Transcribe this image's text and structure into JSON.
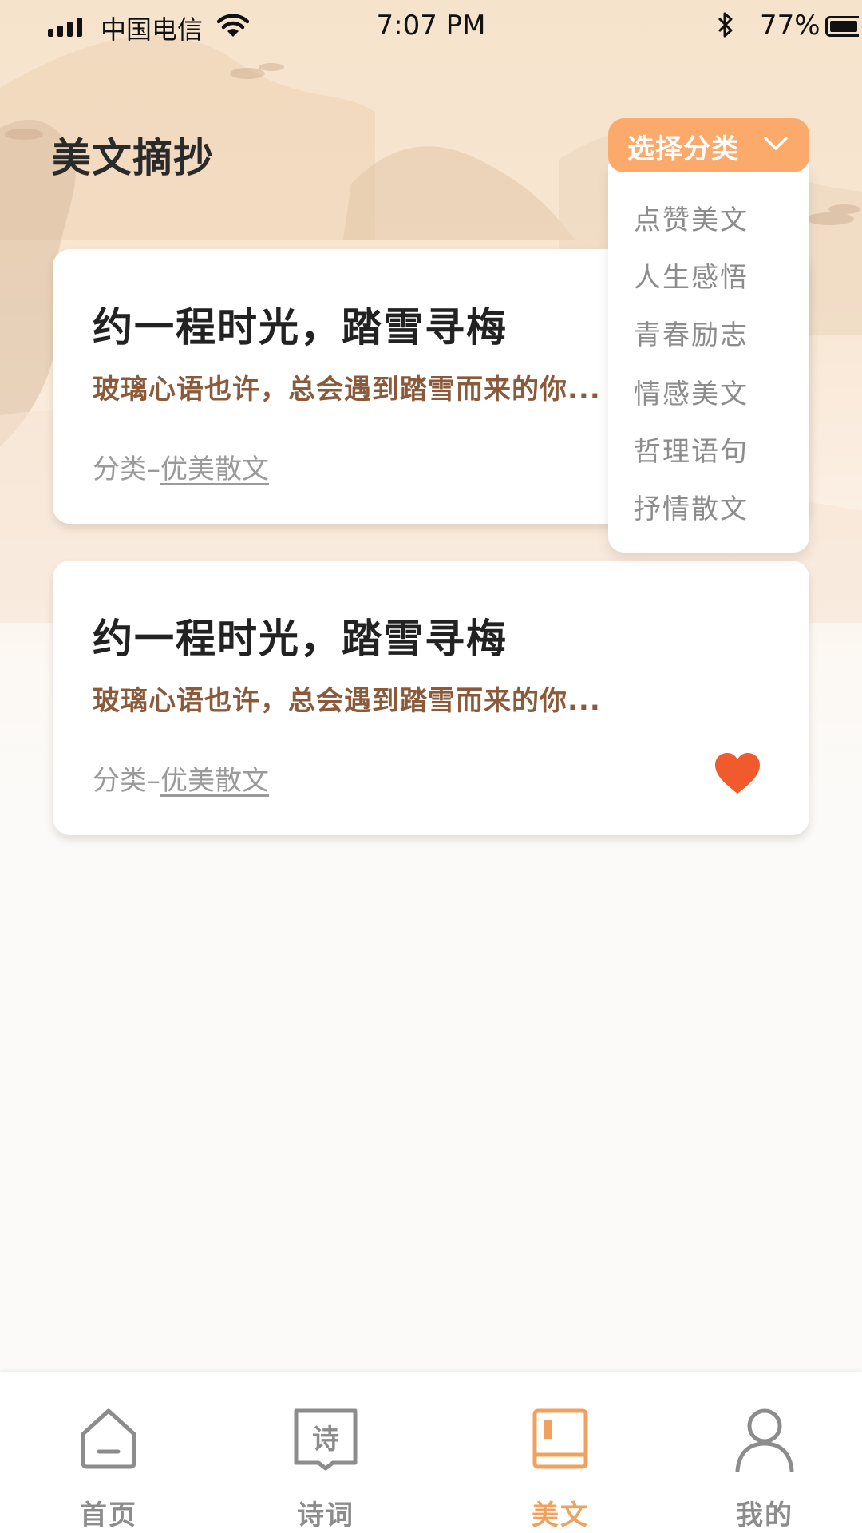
{
  "status_bar": {
    "carrier": "中国电信",
    "time": "7:07 PM",
    "battery": "77%"
  },
  "page": {
    "title": "美文摘抄"
  },
  "category_select": {
    "label": "选择分类",
    "options": [
      "点赞美文",
      "人生感悟",
      "青春励志",
      "情感美文",
      "哲理语句",
      "抒情散文"
    ]
  },
  "articles": [
    {
      "title": "约一程时光，踏雪寻梅",
      "excerpt": "玻璃心语也许，总会遇到踏雪而来的你...",
      "category_prefix": "分类–",
      "category": "优美散文",
      "liked": false
    },
    {
      "title": "约一程时光，踏雪寻梅",
      "excerpt": "玻璃心语也许，总会遇到踏雪而来的你...",
      "category_prefix": "分类–",
      "category": "优美散文",
      "liked": true
    }
  ],
  "tabs": [
    {
      "label": "首页",
      "icon": "home-icon",
      "active": false
    },
    {
      "label": "诗词",
      "icon": "poetry-book-icon",
      "icon_char": "诗",
      "active": false
    },
    {
      "label": "美文",
      "icon": "book-icon",
      "active": true
    },
    {
      "label": "我的",
      "icon": "user-icon",
      "active": false
    }
  ],
  "colors": {
    "accent": "#fbaa6b",
    "active_tab": "#f0a15e",
    "excerpt": "#8a5a3a",
    "heart": "#f15a2c"
  }
}
